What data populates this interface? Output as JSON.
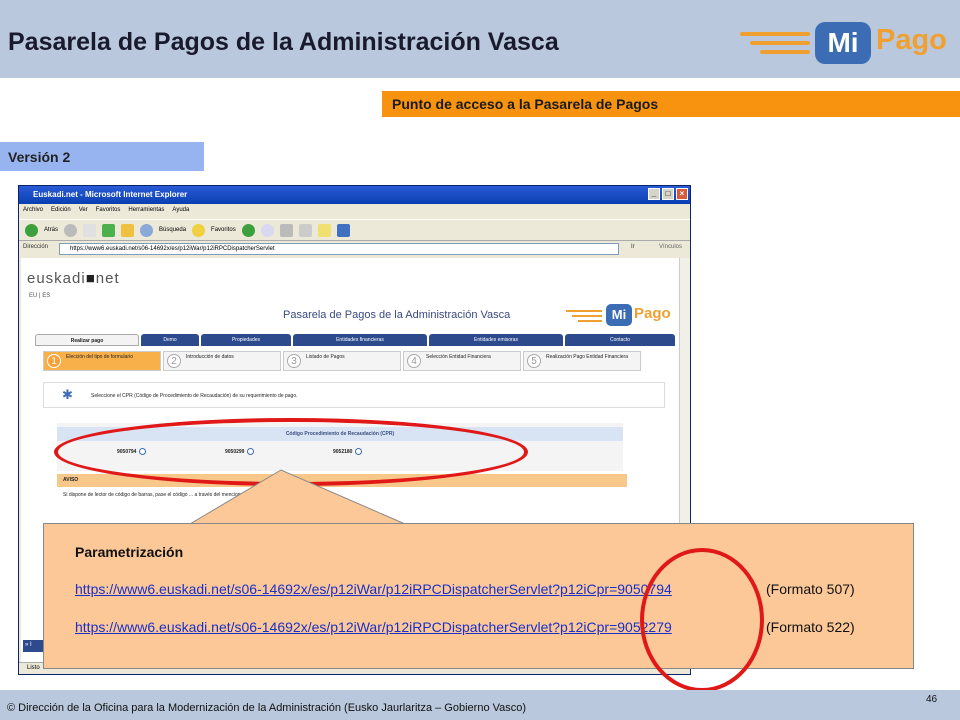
{
  "header": {
    "title": "Pasarela de Pagos de la Administración Vasca",
    "logo_mi": "Mi",
    "logo_pago": "Pago"
  },
  "access_bar": "Punto de acceso a la Pasarela de Pagos",
  "version_label": "Versión 2",
  "browser": {
    "title": "Euskadi.net - Microsoft Internet Explorer",
    "menu": [
      "Archivo",
      "Edición",
      "Ver",
      "Favoritos",
      "Herramientas",
      "Ayuda"
    ],
    "toolbar": {
      "back": "Atrás",
      "search": "Búsqueda",
      "favorites": "Favoritos"
    },
    "address_label": "Dirección",
    "address_value": "https://www6.euskadi.net/s06-14692x/es/p12iWar/p12iRPCDispatcherServlet",
    "go": "Ir",
    "links": "Vínculos",
    "status": "Listo"
  },
  "page": {
    "logo_a": "euskadi",
    "logo_b": "net",
    "lang": "EU  |  ES",
    "title": "Pasarela de Pagos de la Administración Vasca",
    "tabs": [
      "Realizar pago",
      "Demo",
      "Propiedades",
      "Entidades financieras",
      "Entidades emisoras",
      "Contacto"
    ],
    "steps": [
      {
        "n": "1",
        "label": "Elección del tipo de formulario"
      },
      {
        "n": "2",
        "label": "Introducción de datos"
      },
      {
        "n": "3",
        "label": "Listado de Pagos"
      },
      {
        "n": "4",
        "label": "Selección Entidad Financiera"
      },
      {
        "n": "5",
        "label": "Realización Pago Entidad Financiera"
      }
    ],
    "instruction": "Seleccione el CPR (Código de Procedimiento de Recaudación) de su requerimiento de pago.",
    "cpr_header": "Código Procedimiento de Recaudación (CPR)",
    "cpr_options": [
      "9050794",
      "9050299",
      "9052180"
    ],
    "aviso_title": "AVISO",
    "aviso_text": "Si dispone de lector de código de barras, pase el código ... a través del mencionado lector."
  },
  "callout": {
    "title": "Parametrización",
    "link1": "https://www6.euskadi.net/s06-14692x/es/p12iWar/p12iRPCDispatcherServlet?p12iCpr=9050794",
    "format1": "(Formato 507)",
    "link2": "https://www6.euskadi.net/s06-14692x/es/p12iWar/p12iRPCDispatcherServlet?p12iCpr=9052279",
    "format2": "(Formato  522)"
  },
  "footer": {
    "text": "© Dirección de la Oficina para la Modernización de la Administración (Eusko Jaurlaritza – Gobierno Vasco)",
    "page": "46"
  }
}
